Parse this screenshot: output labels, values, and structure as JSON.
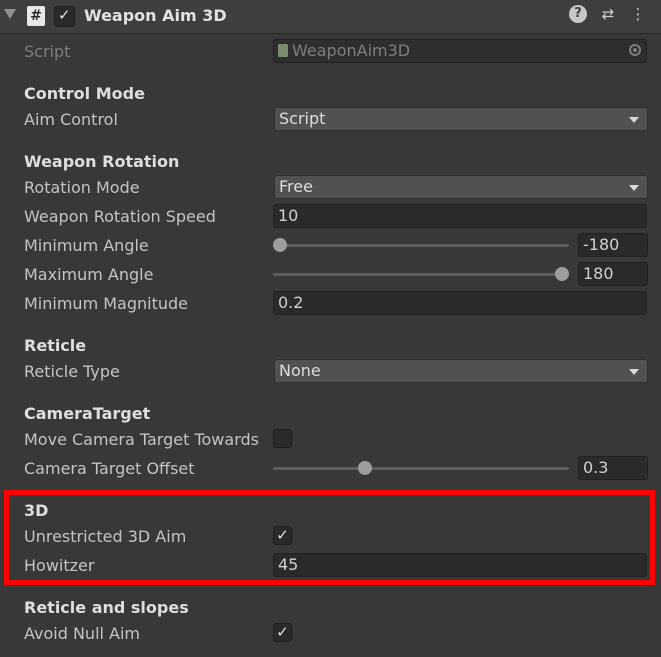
{
  "header": {
    "title": "Weapon Aim 3D",
    "enabled_check": "✓",
    "script_glyph": "#",
    "icons": [
      "help-icon",
      "preset-icon",
      "more-icon"
    ]
  },
  "script": {
    "label": "Script",
    "value": "WeaponAim3D"
  },
  "control_mode": {
    "header": "Control Mode",
    "aim_control": {
      "label": "Aim Control",
      "value": "Script"
    }
  },
  "weapon_rotation": {
    "header": "Weapon Rotation",
    "rotation_mode": {
      "label": "Rotation Mode",
      "value": "Free"
    },
    "rotation_speed": {
      "label": "Weapon Rotation Speed",
      "value": "10"
    },
    "minimum_angle": {
      "label": "Minimum Angle",
      "value": "-180",
      "slider_fraction": 0.0
    },
    "maximum_angle": {
      "label": "Maximum Angle",
      "value": "180",
      "slider_fraction": 1.0
    },
    "minimum_magnitude": {
      "label": "Minimum Magnitude",
      "value": "0.2"
    }
  },
  "reticle": {
    "header": "Reticle",
    "reticle_type": {
      "label": "Reticle Type",
      "value": "None"
    }
  },
  "camera_target": {
    "header": "CameraTarget",
    "move_towards": {
      "label": "Move Camera Target Towards",
      "checked": false
    },
    "offset": {
      "label": "Camera Target Offset",
      "value": "0.3",
      "slider_fraction": 0.3
    }
  },
  "three_d": {
    "header": "3D",
    "unrestricted": {
      "label": "Unrestricted 3D Aim",
      "checked": true,
      "mark": "✓"
    },
    "howitzer": {
      "label": "Howitzer",
      "value": "45"
    }
  },
  "slopes": {
    "header": "Reticle and slopes",
    "avoid_null_aim": {
      "label": "Avoid Null Aim",
      "checked": true,
      "mark": "✓"
    }
  },
  "colors": {
    "highlight": "#ff0000",
    "background": "#383838"
  }
}
